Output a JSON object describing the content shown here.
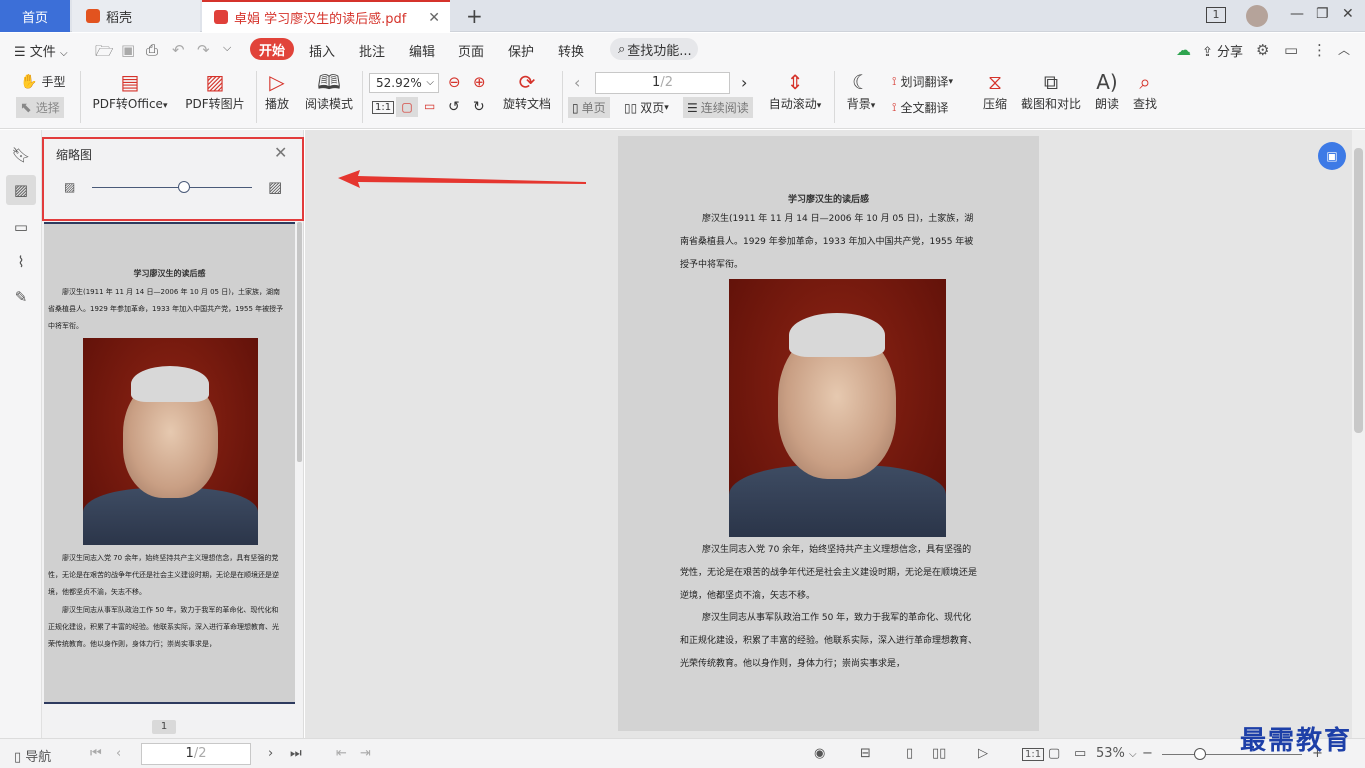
{
  "tabs": {
    "home": "首页",
    "daoke": "稻壳",
    "doc": "卓娟 学习廖汉生的读后感.pdf",
    "add": "+",
    "close": "✕"
  },
  "window": {
    "page_indicator": "1"
  },
  "menu": {
    "file": "文件",
    "start": "开始",
    "insert": "插入",
    "annotate": "批注",
    "edit": "编辑",
    "page": "页面",
    "protect": "保护",
    "convert": "转换",
    "search_func": "查找功能...",
    "share": "分享"
  },
  "ribbon": {
    "hand": "手型",
    "select": "选择",
    "pdf_to_office": "PDF转Office",
    "pdf_to_image": "PDF转图片",
    "play": "播放",
    "read_mode": "阅读模式",
    "zoom": "52.92%",
    "page_current": "1",
    "page_total": "/2",
    "rotate_doc": "旋转文档",
    "single_page": "单页",
    "double_page": "双页",
    "continuous": "连续阅读",
    "auto_scroll": "自动滚动",
    "background": "背景",
    "word_translate": "划词翻译",
    "full_translate": "全文翻译",
    "compress": "压缩",
    "screenshot_compare": "截图和对比",
    "read_aloud": "朗读",
    "find": "查找"
  },
  "thumbnail": {
    "title": "缩略图",
    "page_number": "1"
  },
  "document": {
    "title": "学习廖汉生的读后感",
    "para1": "廖汉生(1911 年 11 月 14 日—2006 年 10 月 05 日)，土家族，湖南省桑植县人。1929 年参加革命，1933 年加入中国共产党，1955 年被授予中将军衔。",
    "para2": "廖汉生同志入党 70 余年，始终坚持共产主义理想信念，具有坚强的党性，无论是在艰苦的战争年代还是社会主义建设时期，无论是在顺境还是逆境，他都坚贞不渝，矢志不移。",
    "para3": "廖汉生同志从事军队政治工作 50 年，致力于我军的革命化、现代化和正规化建设，积累了丰富的经验。他联系实际，深入进行革命理想教育、光荣传统教育。他以身作则，身体力行；崇尚实事求是，"
  },
  "status": {
    "nav": "导航",
    "page_current": "1",
    "page_total": "/2",
    "zoom": "53%"
  },
  "watermark": "最需教育",
  "colors": {
    "accent": "#e1433a",
    "tab_active": "#3c6fd8",
    "highlight_box": "#e23b3b"
  }
}
